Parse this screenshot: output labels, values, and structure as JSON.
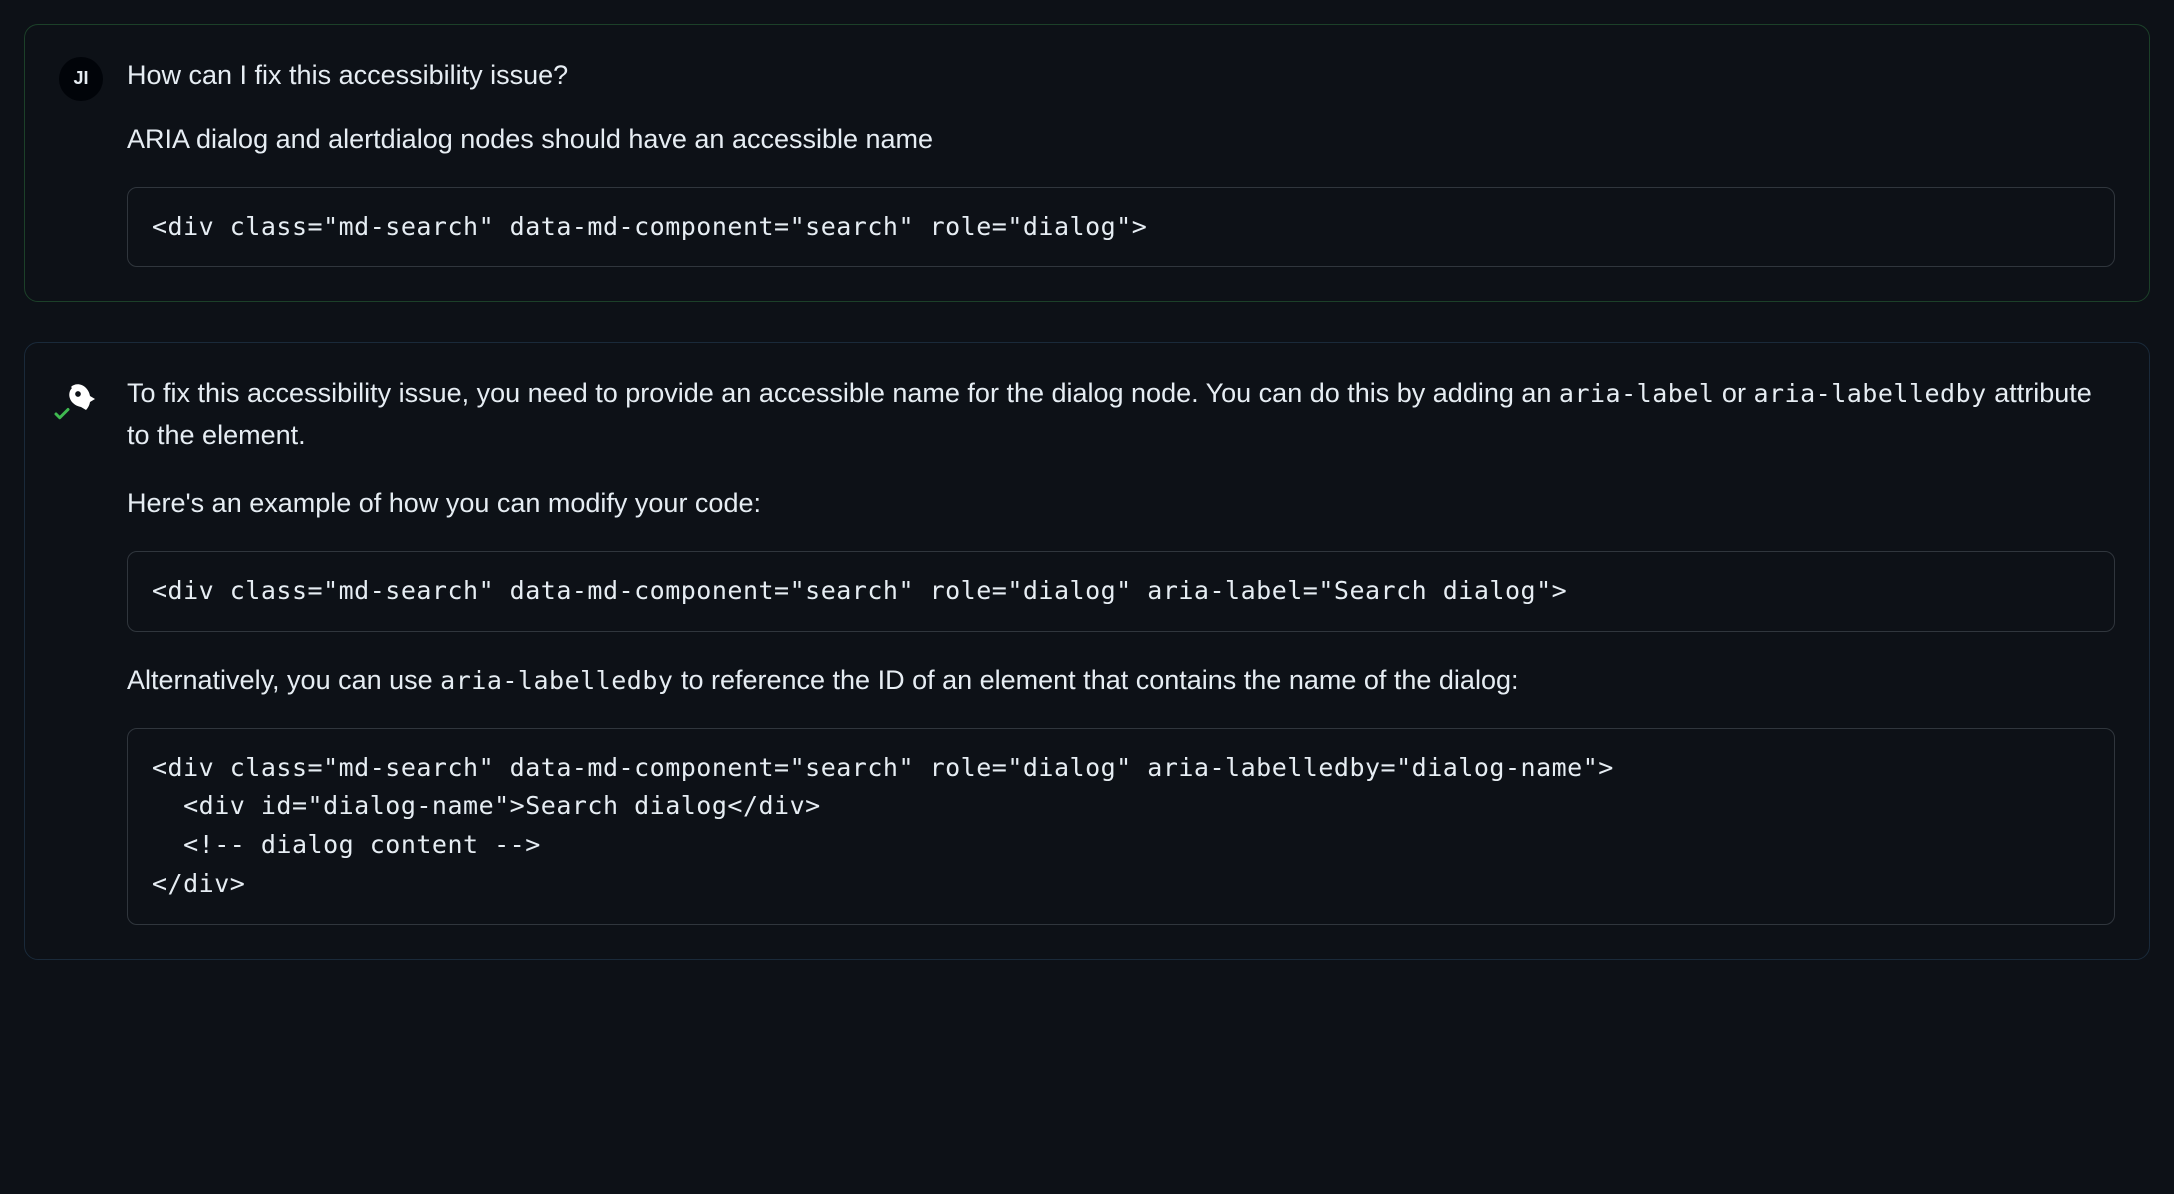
{
  "user": {
    "initials": "JI",
    "question": "How can I fix this accessibility issue?",
    "issue": "ARIA dialog and alertdialog nodes should have an accessible name",
    "code": "<div class=\"md-search\" data-md-component=\"search\" role=\"dialog\">"
  },
  "assistant": {
    "p1_pre": "To fix this accessibility issue, you need to provide an accessible name for the dialog node. You can do this by adding an ",
    "p1_code1": "aria-label",
    "p1_mid": " or ",
    "p1_code2": "aria-labelledby",
    "p1_post": " attribute to the element.",
    "p2": "Here's an example of how you can modify your code:",
    "code1": "<div class=\"md-search\" data-md-component=\"search\" role=\"dialog\" aria-label=\"Search dialog\">",
    "p3_pre": "Alternatively, you can use ",
    "p3_code": "aria-labelledby",
    "p3_post": " to reference the ID of an element that contains the name of the dialog:",
    "code2": "<div class=\"md-search\" data-md-component=\"search\" role=\"dialog\" aria-labelledby=\"dialog-name\">\n  <div id=\"dialog-name\">Search dialog</div>\n  <!-- dialog content -->\n</div>"
  }
}
